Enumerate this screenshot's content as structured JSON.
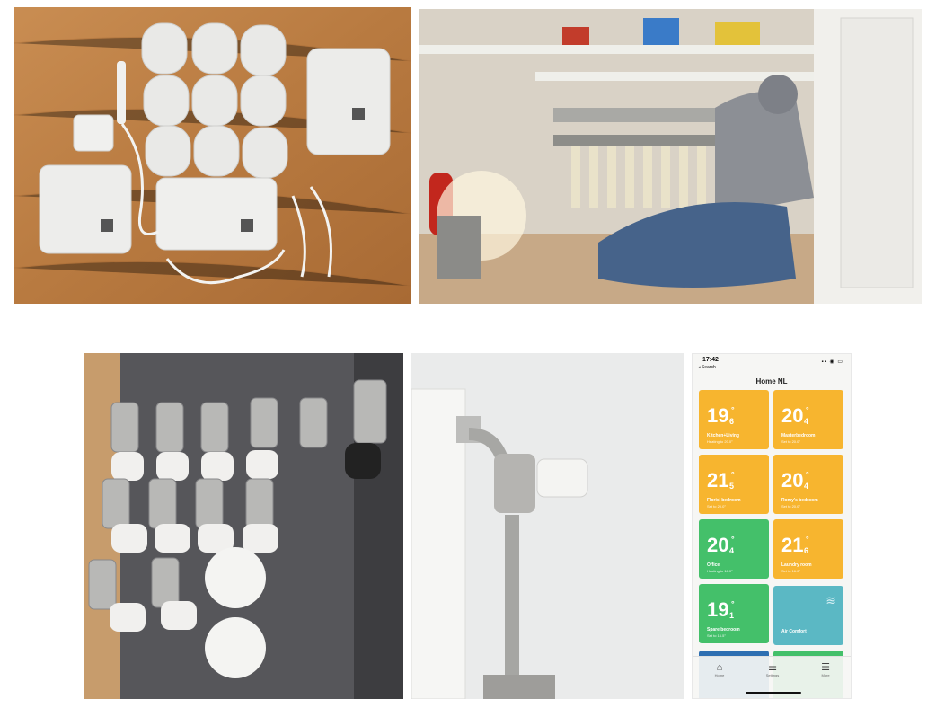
{
  "photos": [
    {
      "name": "smart-thermostat-kit-photo"
    },
    {
      "name": "manifold-installation-photo"
    },
    {
      "name": "radiator-valves-photo"
    },
    {
      "name": "radiator-thermostat-photo"
    }
  ],
  "phone": {
    "status_time": "17:42",
    "back_label": "◂ Search",
    "system_icons": "▪▪ ◉ ▭",
    "home_title": "Home NL",
    "rooms": [
      {
        "temp": "19",
        "decimal": "6",
        "name": "Kitchen+Living",
        "status": "Heating to 20.0°",
        "color": "#f7b52f"
      },
      {
        "temp": "20",
        "decimal": "4",
        "name": "Masterbedroom",
        "status": "Set to 20.0°",
        "color": "#f7b52f"
      },
      {
        "temp": "21",
        "decimal": "5",
        "name": "Floris' bedroom",
        "status": "Set to 20.0°",
        "color": "#f7b52f"
      },
      {
        "temp": "20",
        "decimal": "4",
        "name": "Romy's bedroom",
        "status": "Set to 20.0°",
        "color": "#f7b52f"
      },
      {
        "temp": "20",
        "decimal": "4",
        "name": "Office",
        "status": "Heating to 18.0°",
        "color": "#44c06a"
      },
      {
        "temp": "21",
        "decimal": "6",
        "name": "Laundry room",
        "status": "Set to 16.0°",
        "color": "#f7b52f"
      },
      {
        "temp": "19",
        "decimal": "1",
        "name": "Spare bedroom",
        "status": "Set to 16.5°",
        "color": "#44c06a"
      }
    ],
    "air_comfort_label": "Air Comfort",
    "air_comfort_color": "#5bb8c4",
    "tabs": [
      {
        "label": "Home",
        "icon": "⌂"
      },
      {
        "label": "Settings",
        "icon": "⚌"
      },
      {
        "label": "More",
        "icon": "☰"
      }
    ]
  }
}
